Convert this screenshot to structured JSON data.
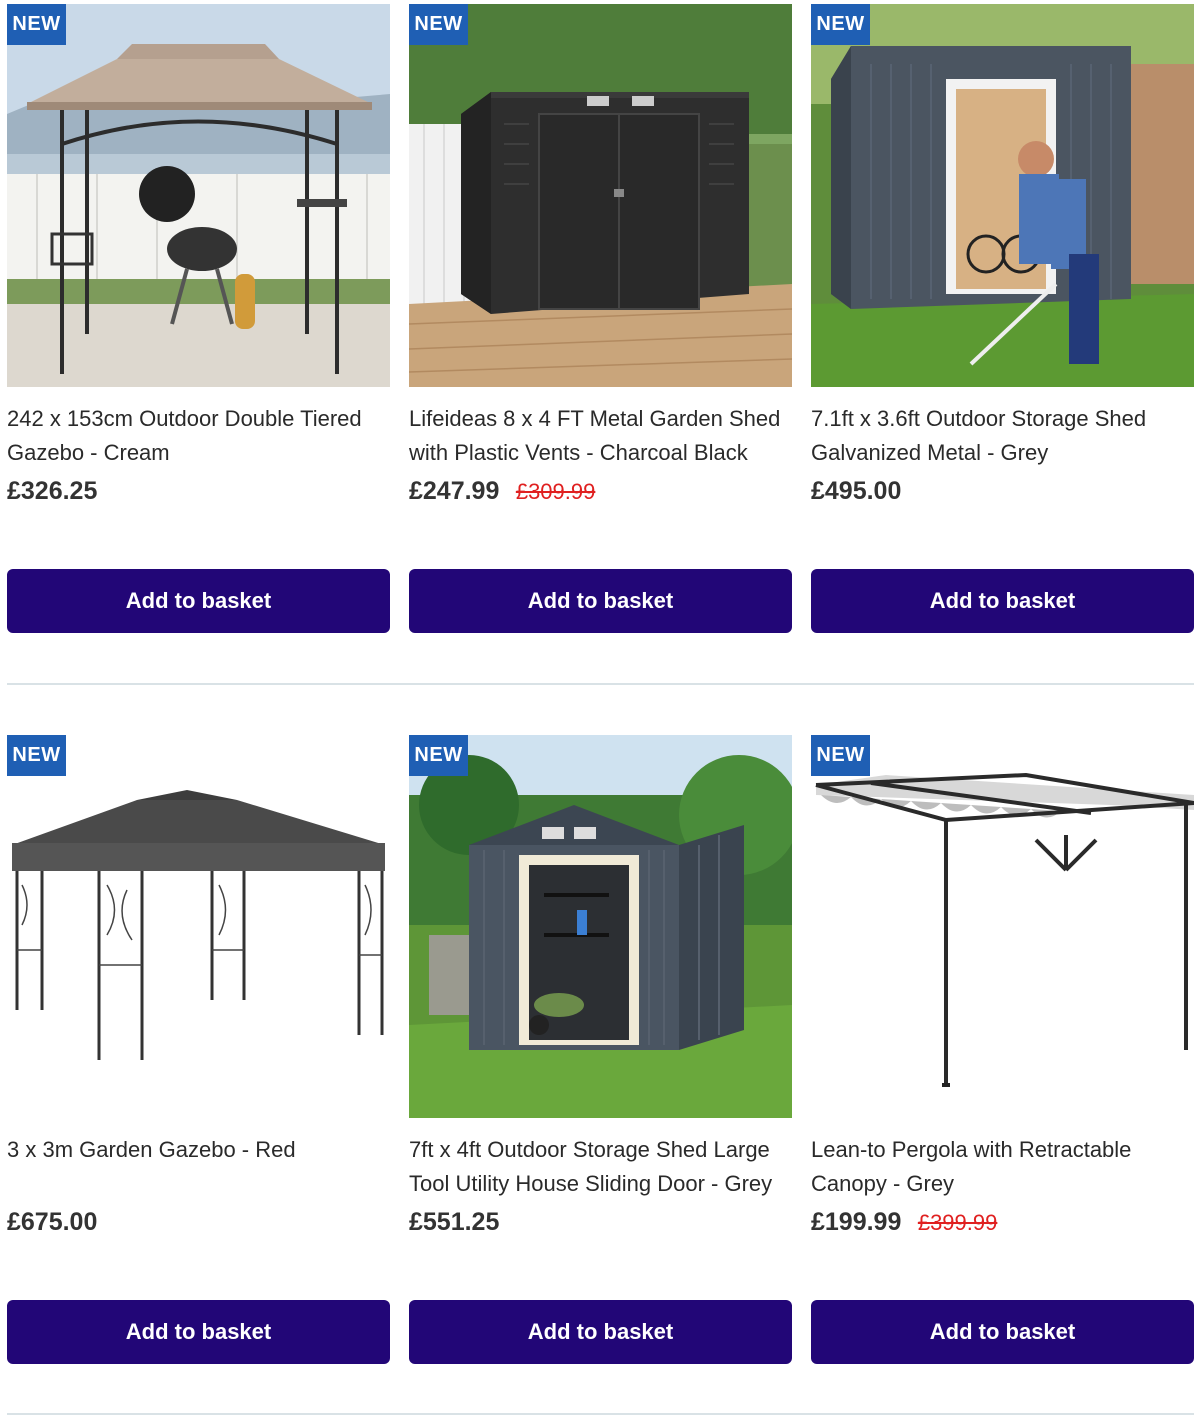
{
  "products": [
    {
      "badge": "NEW",
      "title": "242 x 153cm Outdoor Double Tiered Gazebo - Cream",
      "price": "£326.25",
      "was_price": "",
      "button": "Add to basket"
    },
    {
      "badge": "NEW",
      "title": "Lifeideas 8 x 4 FT Metal Garden Shed with Plastic Vents - Charcoal Black",
      "price": "£247.99",
      "was_price": "£309.99",
      "button": "Add to basket"
    },
    {
      "badge": "NEW",
      "title": "7.1ft x 3.6ft Outdoor Storage Shed Galvanized Metal - Grey",
      "price": "£495.00",
      "was_price": "",
      "button": "Add to basket"
    },
    {
      "badge": "NEW",
      "title": "3 x 3m Garden Gazebo - Red",
      "price": "£675.00",
      "was_price": "",
      "button": "Add to basket"
    },
    {
      "badge": "NEW",
      "title": "7ft x 4ft Outdoor Storage Shed Large Tool Utility House Sliding Door - Grey",
      "price": "£551.25",
      "was_price": "",
      "button": "Add to basket"
    },
    {
      "badge": "NEW",
      "title": "Lean-to Pergola with Retractable Canopy - Grey",
      "price": "£199.99",
      "was_price": "£399.99",
      "button": "Add to basket"
    }
  ],
  "colors": {
    "badge": "#1f5fb4",
    "button": "#220677",
    "was_price": "#e02020"
  }
}
